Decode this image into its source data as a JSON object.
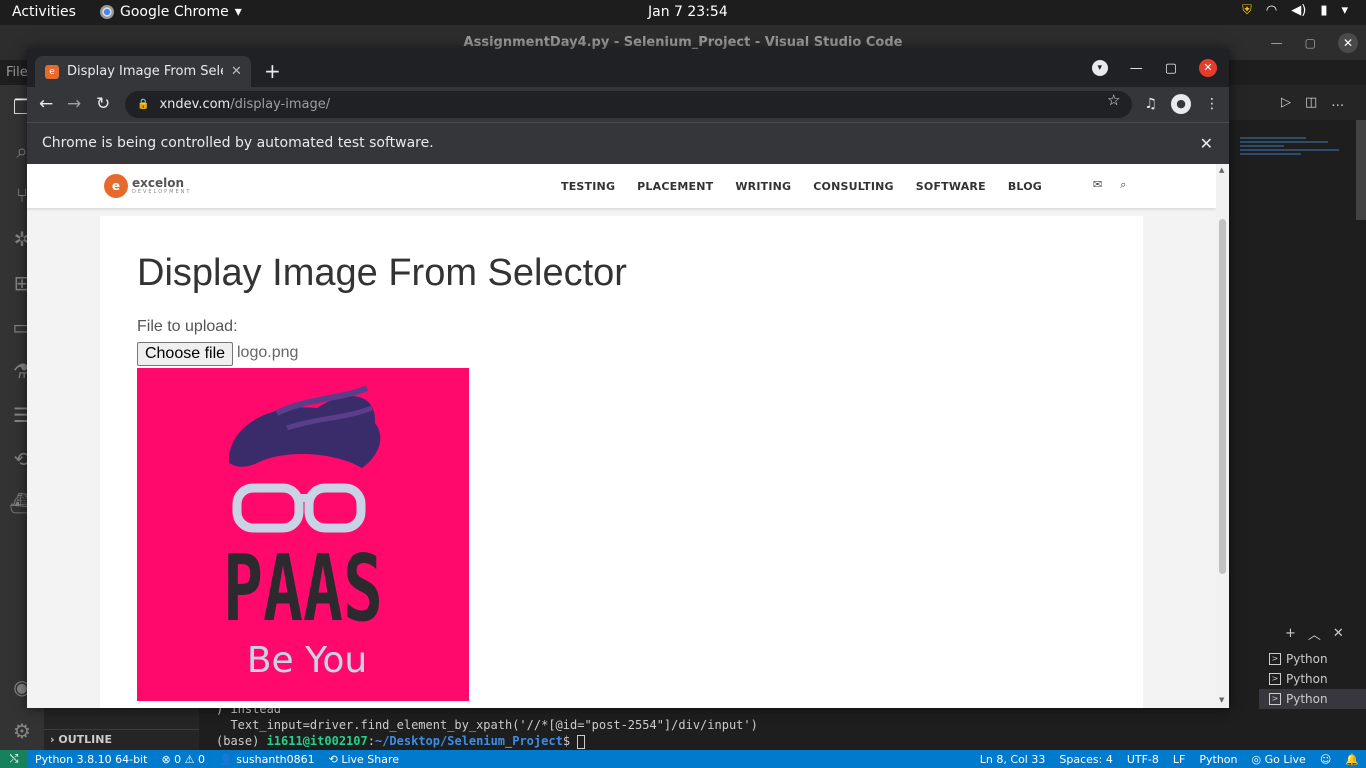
{
  "topbar": {
    "activities": "Activities",
    "app_name": "Google Chrome",
    "clock": "Jan 7  23:54"
  },
  "vscode": {
    "window_title": "AssignmentDay4.py - Selenium_Project - Visual Studio Code",
    "menu_file": "File",
    "outline": "OUTLINE",
    "terminals": [
      "Python",
      "Python",
      "Python"
    ],
    "terminal_lines": [
      ") instead",
      "  Text_input=driver.find_element_by_xpath('//*[@id=\"post-2554\"]/div/input')"
    ],
    "prompt_env": "(base) ",
    "prompt_user": "i1611@it002107",
    "prompt_path": "~/Desktop/Selenium_Project",
    "prompt_end": "$ "
  },
  "statusbar": {
    "python": "Python 3.8.10 64-bit",
    "problems": "⊗ 0 ⚠ 0",
    "user": "sushanth0861",
    "live_share": "Live Share",
    "position": "Ln 8, Col 33",
    "spaces": "Spaces: 4",
    "encoding": "UTF-8",
    "eol": "LF",
    "language": "Python",
    "go_live": "Go Live"
  },
  "chrome": {
    "tab_title": "Display Image From Selector",
    "url_host": "xndev.com",
    "url_path": "/display-image/",
    "infobar": "Chrome is being controlled by automated test software."
  },
  "site": {
    "logo_name": "excelon",
    "logo_sub": "DEVELOPMENT",
    "menu": [
      "TESTING",
      "PLACEMENT",
      "WRITING",
      "CONSULTING",
      "SOFTWARE",
      "BLOG"
    ],
    "page_title": "Display Image From Selector",
    "file_label": "File to upload:",
    "choose_button": "Choose file",
    "file_name": "logo.png",
    "preview_text": "PAAS",
    "preview_tagline": "Be You",
    "preview_bg": "#ff0a6c"
  }
}
